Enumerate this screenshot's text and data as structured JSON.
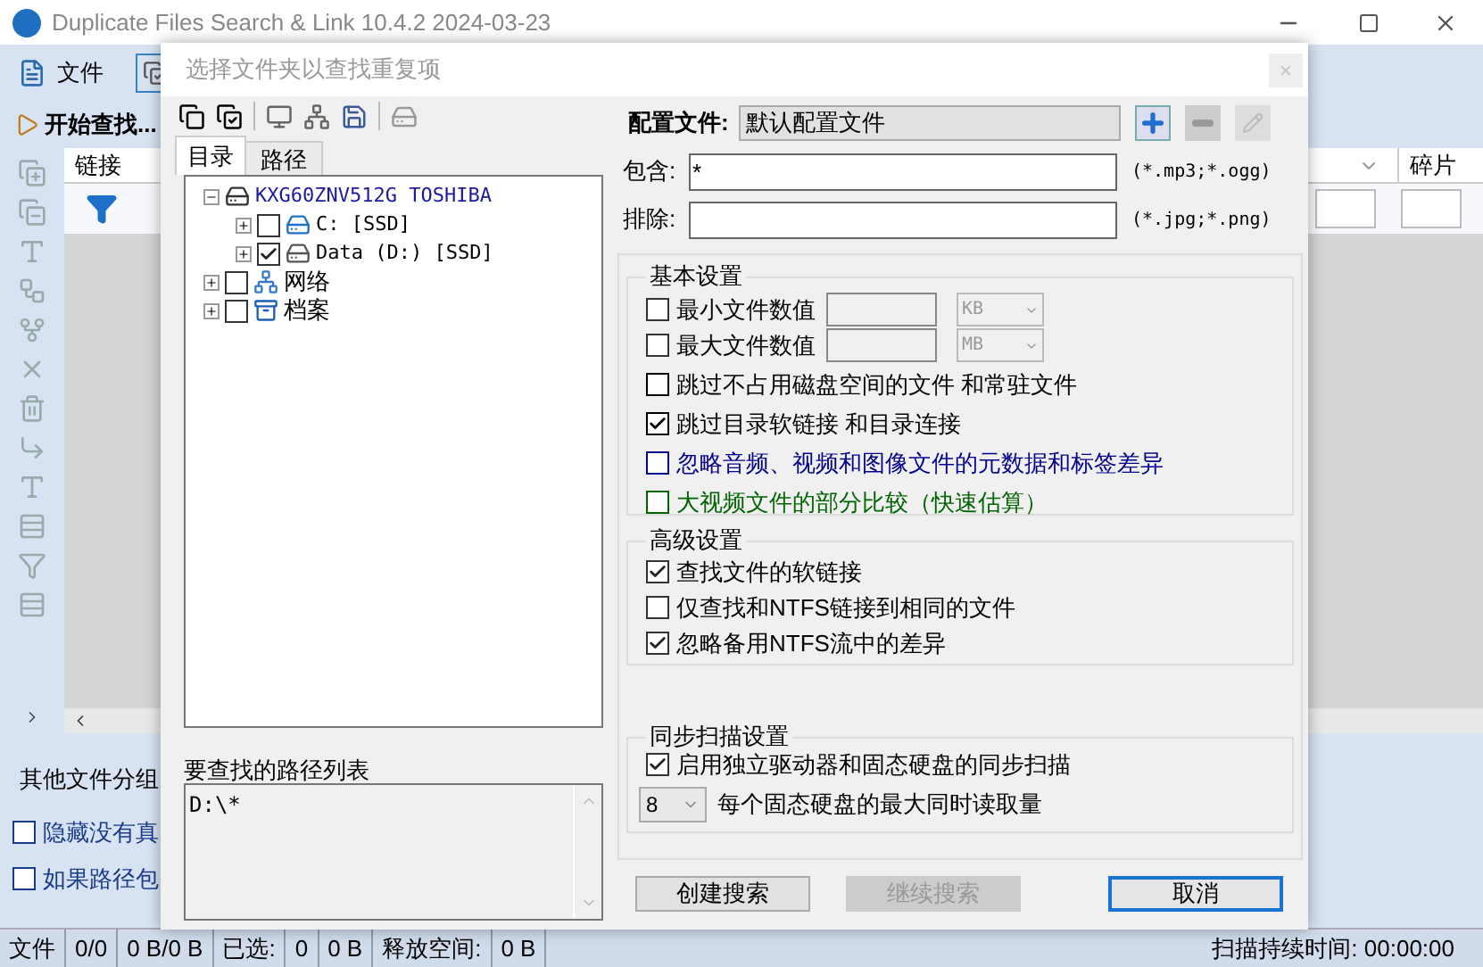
{
  "window": {
    "title": "Duplicate Files Search & Link 10.4.2 2024-03-23"
  },
  "main_toolbar": {
    "file_menu": "文件",
    "start_search": "开始查找..."
  },
  "table": {
    "columns": [
      {
        "label": "链接"
      },
      {
        "label": "碎片"
      }
    ]
  },
  "group_label": "其他文件分组",
  "options": [
    {
      "label": "隐藏没有真",
      "checked": false
    },
    {
      "label": "如果路径包",
      "checked": false
    }
  ],
  "status_bar": {
    "cells": [
      "文件",
      "0/0",
      "0 B/0 B",
      "已选:",
      "0",
      "0 B",
      "释放空间:",
      "0 B"
    ],
    "scan_time": "扫描持续时间: 00:00:00"
  },
  "dialog": {
    "title": "选择文件夹以查找重复项",
    "tabs": [
      {
        "label": "目录",
        "selected": true
      },
      {
        "label": "路径",
        "selected": false
      }
    ],
    "tree": [
      {
        "label": "KXG60ZNV512G TOSHIBA",
        "kind": "disk",
        "expanded": true,
        "children": [
          {
            "label": "C: [SSD]",
            "kind": "system",
            "checked": false,
            "expanded": false
          },
          {
            "label": "Data (D:) [SSD]",
            "kind": "drive",
            "checked": true,
            "expanded": false
          }
        ]
      },
      {
        "label": "网络",
        "kind": "network",
        "checked": false,
        "expanded": false
      },
      {
        "label": "档案",
        "kind": "archive",
        "checked": false,
        "expanded": false
      }
    ],
    "path_list": {
      "label": "要查找的路径列表",
      "value": "D:\\*"
    },
    "profile": {
      "label": "配置文件:",
      "value": "默认配置文件"
    },
    "include": {
      "label": "包含:",
      "value": "*",
      "hint": "(*.mp3;*.ogg)"
    },
    "exclude": {
      "label": "排除:",
      "hint": "(*.jpg;*.png)"
    },
    "basic": {
      "title": "基本设置",
      "size_filters": [
        {
          "label": "最小文件数值",
          "checked": false,
          "unit": "KB"
        },
        {
          "label": "最大文件数值",
          "checked": false,
          "unit": "MB"
        }
      ],
      "options": [
        {
          "label": "跳过不占用磁盘空间的文件 和常驻文件",
          "checked": false,
          "color": "#000000"
        },
        {
          "label": "跳过目录软链接 和目录连接",
          "checked": true,
          "color": "#000000"
        },
        {
          "label": "忽略音频、视频和图像文件的元数据和标签差异",
          "checked": false,
          "color": "#00008b"
        },
        {
          "label": "大视频文件的部分比较（快速估算）",
          "checked": false,
          "color": "#006400"
        }
      ]
    },
    "advanced": {
      "title": "高级设置",
      "options": [
        {
          "label": "查找文件的软链接",
          "checked": true
        },
        {
          "label": "仅查找和NTFS链接到相同的文件",
          "checked": false
        },
        {
          "label": "忽略备用NTFS流中的差异",
          "checked": true
        }
      ]
    },
    "sync": {
      "title": "同步扫描设置",
      "enable": {
        "label": "启用独立驱动器和固态硬盘的同步扫描",
        "checked": true
      },
      "reads": {
        "value": "8",
        "label": "每个固态硬盘的最大同时读取量"
      }
    },
    "buttons": [
      {
        "label": "创建搜索",
        "disabled": false,
        "default": false
      },
      {
        "label": "继续搜索",
        "disabled": true,
        "default": false
      },
      {
        "label": "取消",
        "disabled": false,
        "default": true
      }
    ]
  }
}
